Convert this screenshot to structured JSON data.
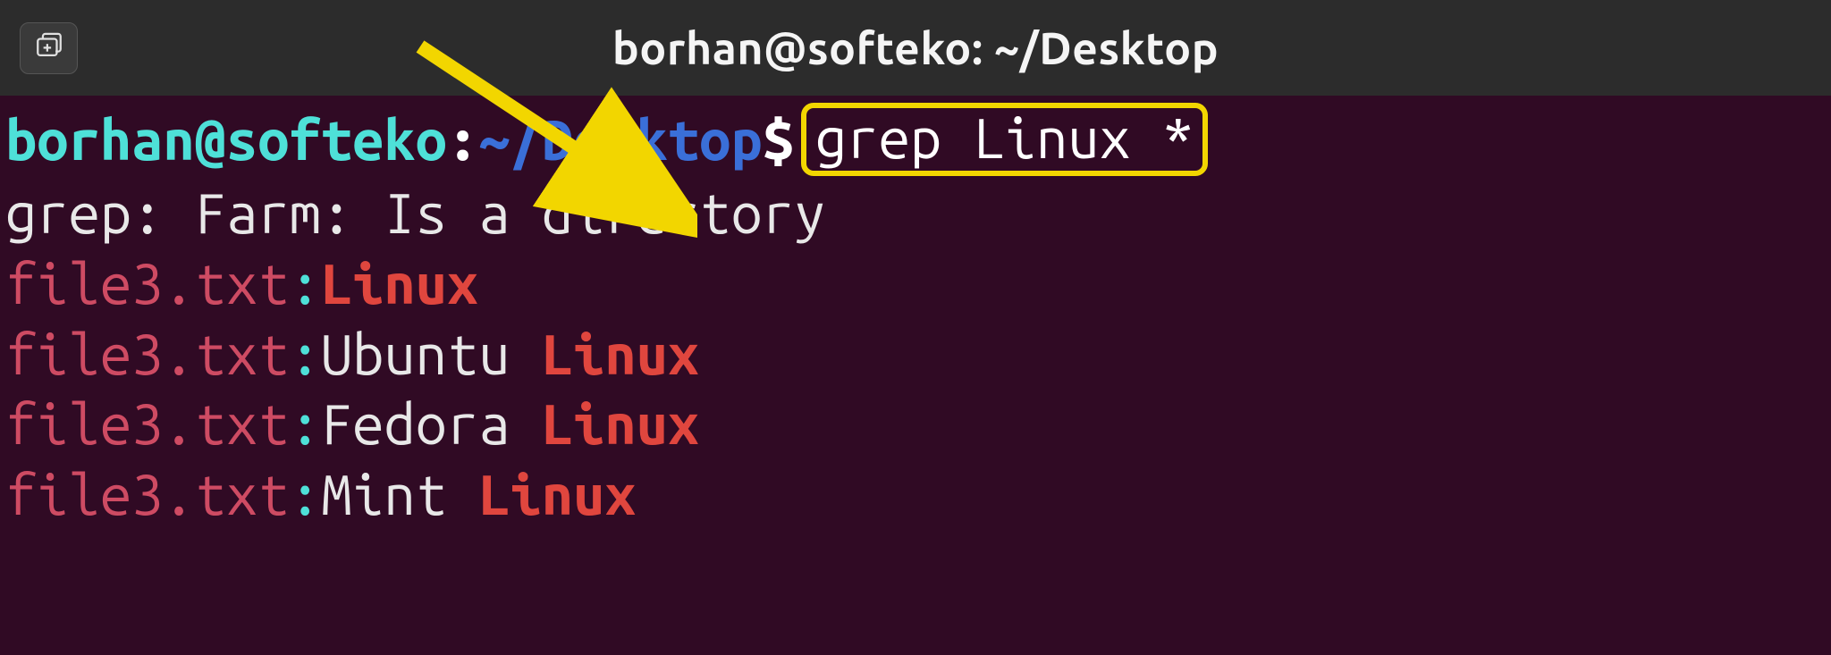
{
  "titlebar": {
    "window_title": "borhan@softeko: ~/Desktop"
  },
  "prompt": {
    "user_host": "borhan@softeko",
    "separator": ":",
    "path": "~/Desktop",
    "symbol": "$"
  },
  "command": {
    "text": "grep Linux *"
  },
  "output": {
    "warning": "grep: Farm: Is a directory",
    "lines": [
      {
        "file": "file3.txt",
        "before": "",
        "match": "Linux",
        "after": ""
      },
      {
        "file": "file3.txt",
        "before": "Ubuntu ",
        "match": "Linux",
        "after": ""
      },
      {
        "file": "file3.txt",
        "before": "Fedora ",
        "match": "Linux",
        "after": ""
      },
      {
        "file": "file3.txt",
        "before": "Mint ",
        "match": "Linux",
        "after": ""
      }
    ]
  },
  "colors": {
    "terminal_bg": "#300a24",
    "titlebar_bg": "#2c2c2c",
    "prompt_user": "#4ee0d8",
    "prompt_path": "#3a6fd8",
    "match_highlight": "#e0463e",
    "filename": "#ce4b63",
    "annotation": "#f2d600"
  },
  "icons": {
    "new_tab": "new-tab-icon"
  }
}
